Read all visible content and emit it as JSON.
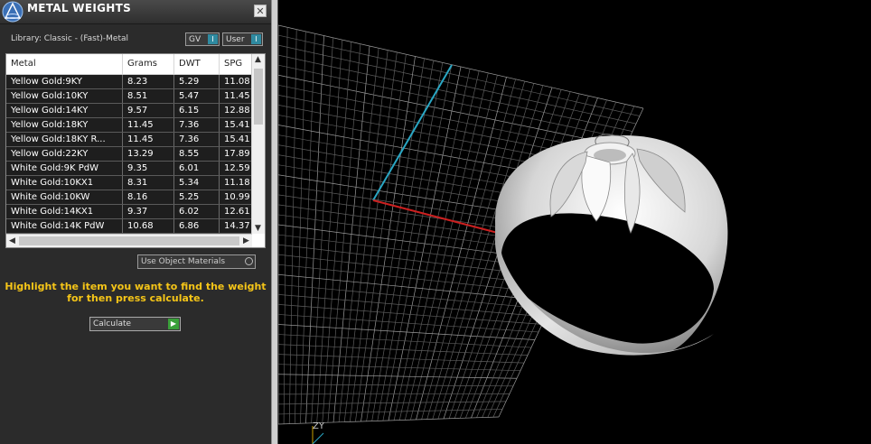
{
  "window": {
    "title": "METAL WEIGHTS",
    "close_glyph": "✕"
  },
  "library": {
    "label": "Library: Classic - (Fast)-Metal"
  },
  "toggles": [
    {
      "label": "GV",
      "indicator": "I"
    },
    {
      "label": "User",
      "indicator": "I"
    }
  ],
  "table": {
    "columns": [
      "Metal",
      "Grams",
      "DWT",
      "SPG"
    ],
    "rows": [
      [
        "Yellow Gold:9KY",
        "8.23",
        "5.29",
        "11.08"
      ],
      [
        "Yellow Gold:10KY",
        "8.51",
        "5.47",
        "11.45"
      ],
      [
        "Yellow Gold:14KY",
        "9.57",
        "6.15",
        "12.88"
      ],
      [
        "Yellow Gold:18KY",
        "11.45",
        "7.36",
        "15.41"
      ],
      [
        "Yellow Gold:18KY R...",
        "11.45",
        "7.36",
        "15.41"
      ],
      [
        "Yellow Gold:22KY",
        "13.29",
        "8.55",
        "17.89"
      ],
      [
        "White Gold:9K PdW",
        "9.35",
        "6.01",
        "12.59"
      ],
      [
        "White Gold:10KX1",
        "8.31",
        "5.34",
        "11.18"
      ],
      [
        "White Gold:10KW",
        "8.16",
        "5.25",
        "10.99"
      ],
      [
        "White Gold:14KX1",
        "9.37",
        "6.02",
        "12.61"
      ],
      [
        "White Gold:14K PdW",
        "10.68",
        "6.86",
        "14.37"
      ]
    ]
  },
  "options": {
    "use_object_materials": "Use Object Materials"
  },
  "instruction": {
    "line1": "Highlight the item you want to find the weight",
    "line2": "for then press calculate."
  },
  "calculate": {
    "label": "Calculate"
  },
  "viewport": {
    "axis_label": "ZY"
  },
  "colors": {
    "accent": "#f5c518",
    "axis_x": "#cc2020",
    "axis_y": "#2aa7c4",
    "toggle": "#2f8aa0"
  }
}
